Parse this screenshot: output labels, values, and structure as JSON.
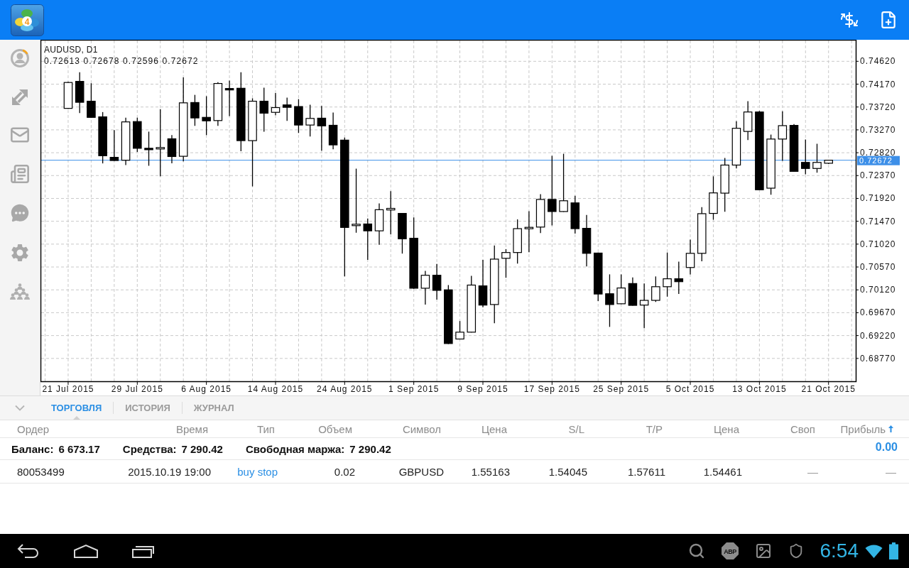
{
  "top_bar": {
    "logo_text": "4"
  },
  "chart": {
    "chart_data": [
      {
        "type": "candlestick",
        "title": "AUDUSD, D1",
        "subtitle": "0.72613 0.72678 0.72596 0.72672",
        "grid": true,
        "categories": [
          "21 Jul 2015",
          null,
          null,
          null,
          null,
          null,
          "29 Jul 2015",
          null,
          null,
          null,
          null,
          null,
          "6 Aug 2015",
          null,
          null,
          null,
          null,
          null,
          "14 Aug 2015",
          null,
          null,
          null,
          null,
          null,
          "24 Aug 2015",
          null,
          null,
          null,
          null,
          null,
          "1 Sep 2015",
          null,
          null,
          null,
          null,
          null,
          "9 Sep 2015",
          null,
          null,
          null,
          null,
          null,
          "17 Sep 2015",
          null,
          null,
          null,
          null,
          null,
          "25 Sep 2015",
          null,
          null,
          null,
          null,
          null,
          "5 Oct 2015",
          null,
          null,
          null,
          null,
          null,
          "13 Oct 2015",
          null,
          null,
          null,
          null,
          null,
          "21 Oct 2015"
        ],
        "ohlc": [
          [
            0.73693,
            0.74214,
            0.73683,
            0.74203
          ],
          [
            0.74224,
            0.74406,
            0.73599,
            0.73813
          ],
          [
            0.73834,
            0.74188,
            0.73511,
            0.73516
          ],
          [
            0.73526,
            0.7362,
            0.7261,
            0.72761
          ],
          [
            0.72729,
            0.73266,
            0.7266,
            0.72667
          ],
          [
            0.72672,
            0.73511,
            0.72578,
            0.73427
          ],
          [
            0.73433,
            0.73511,
            0.72834,
            0.72907
          ],
          [
            0.72907,
            0.73235,
            0.72563,
            0.72896
          ],
          [
            0.72896,
            0.73677,
            0.72355,
            0.72922
          ],
          [
            0.73094,
            0.73167,
            0.7261,
            0.72745
          ],
          [
            0.7275,
            0.74302,
            0.72651,
            0.73802
          ],
          [
            0.73808,
            0.73959,
            0.73349,
            0.73505
          ],
          [
            0.73516,
            0.73933,
            0.73167,
            0.73448
          ],
          [
            0.73453,
            0.74209,
            0.73349,
            0.74183
          ],
          [
            0.74084,
            0.7424,
            0.73542,
            0.74078
          ],
          [
            0.74089,
            0.74406,
            0.72849,
            0.73058
          ],
          [
            0.73058,
            0.73891,
            0.72157,
            0.73834
          ],
          [
            0.73834,
            0.74099,
            0.73235,
            0.73599
          ],
          [
            0.73615,
            0.73995,
            0.73558,
            0.73709
          ],
          [
            0.73761,
            0.73906,
            0.73448,
            0.73714
          ],
          [
            0.73729,
            0.73875,
            0.73209,
            0.73365
          ],
          [
            0.73365,
            0.73766,
            0.73141,
            0.73495
          ],
          [
            0.735,
            0.7374,
            0.7286,
            0.73349
          ],
          [
            0.7336,
            0.7361,
            0.72886,
            0.72974
          ],
          [
            0.73068,
            0.7312,
            0.70386,
            0.71349
          ],
          [
            0.71386,
            0.72506,
            0.71245,
            0.71412
          ],
          [
            0.71417,
            0.71526,
            0.70709,
            0.71282
          ],
          [
            0.71282,
            0.71823,
            0.71006,
            0.71698
          ],
          [
            0.71693,
            0.72063,
            0.71214,
            0.71724
          ],
          [
            0.71625,
            0.7163,
            0.70834,
            0.71125
          ],
          [
            0.71136,
            0.71547,
            0.70141,
            0.70152
          ],
          [
            0.70152,
            0.70495,
            0.69829,
            0.70407
          ],
          [
            0.70407,
            0.70631,
            0.69928,
            0.7011
          ],
          [
            0.7012,
            0.70214,
            0.69055,
            0.69063
          ],
          [
            0.69152,
            0.69506,
            0.69145,
            0.69287
          ],
          [
            0.69287,
            0.70396,
            0.6928,
            0.70214
          ],
          [
            0.70198,
            0.7071,
            0.69779,
            0.6982
          ],
          [
            0.69831,
            0.70994,
            0.69464,
            0.70725
          ],
          [
            0.70741,
            0.70922,
            0.70358,
            0.70855
          ],
          [
            0.70855,
            0.71506,
            0.70638,
            0.71325
          ],
          [
            0.71325,
            0.71667,
            0.7086,
            0.71351
          ],
          [
            0.71356,
            0.72003,
            0.71238,
            0.719
          ],
          [
            0.719,
            0.72758,
            0.71387,
            0.71662
          ],
          [
            0.71662,
            0.72799,
            0.71655,
            0.71874
          ],
          [
            0.71832,
            0.71972,
            0.71227,
            0.71325
          ],
          [
            0.71331,
            0.71594,
            0.70581,
            0.70839
          ],
          [
            0.70844,
            0.70855,
            0.69898,
            0.70038
          ],
          [
            0.70043,
            0.70425,
            0.69391,
            0.69831
          ],
          [
            0.69846,
            0.70425,
            0.6984,
            0.70157
          ],
          [
            0.70244,
            0.70363,
            0.6981,
            0.69815
          ],
          [
            0.6982,
            0.70244,
            0.69365,
            0.69913
          ],
          [
            0.69913,
            0.70384,
            0.69882,
            0.70182
          ],
          [
            0.70182,
            0.70855,
            0.69986,
            0.70338
          ],
          [
            0.70338,
            0.70674,
            0.70038,
            0.70281
          ],
          [
            0.7056,
            0.71108,
            0.70425,
            0.70839
          ],
          [
            0.70839,
            0.7175,
            0.70684,
            0.7162
          ],
          [
            0.71625,
            0.72355,
            0.71501,
            0.72029
          ],
          [
            0.72024,
            0.72717,
            0.71656,
            0.72577
          ],
          [
            0.72577,
            0.73441,
            0.7251,
            0.73301
          ],
          [
            0.73239,
            0.73834,
            0.73068,
            0.73622
          ],
          [
            0.73622,
            0.73642,
            0.72085,
            0.72091
          ],
          [
            0.72122,
            0.73177,
            0.71993,
            0.73089
          ],
          [
            0.73089,
            0.73637,
            0.7266,
            0.73353
          ],
          [
            0.73358,
            0.73384,
            0.7245,
            0.72453
          ],
          [
            0.72629,
            0.73079,
            0.72396,
            0.7251
          ],
          [
            0.7251,
            0.72996,
            0.72427,
            0.72629
          ],
          [
            0.72613,
            0.72678,
            0.72596,
            0.72672
          ]
        ],
        "ylim": [
          0.6832,
          0.7503
        ],
        "yticks": [
          {
            "value": 0.7462,
            "label": "0.74620"
          },
          {
            "value": 0.7417,
            "label": "0.74170"
          },
          {
            "value": 0.7372,
            "label": "0.73720"
          },
          {
            "value": 0.7327,
            "label": "0.73270"
          },
          {
            "value": 0.7282,
            "label": "0.72820"
          },
          {
            "value": 0.7237,
            "label": "0.72370"
          },
          {
            "value": 0.7192,
            "label": "0.71920"
          },
          {
            "value": 0.7147,
            "label": "0.71470"
          },
          {
            "value": 0.7102,
            "label": "0.71020"
          },
          {
            "value": 0.7057,
            "label": "0.70570"
          },
          {
            "value": 0.7012,
            "label": "0.70120"
          },
          {
            "value": 0.6967,
            "label": "0.69670"
          },
          {
            "value": 0.6922,
            "label": "0.69220"
          },
          {
            "value": 0.6877,
            "label": "0.68770"
          }
        ],
        "ref_lines": [
          {
            "axis": "y",
            "value": 0.72672,
            "label": "0.72672",
            "color": "#3d8fe8"
          }
        ]
      }
    ]
  },
  "trade_panel": {
    "tabs": [
      {
        "label": "ТОРГОВЛЯ",
        "selected": true
      },
      {
        "label": "ИСТОРИЯ",
        "selected": false
      },
      {
        "label": "ЖУРНАЛ",
        "selected": false
      }
    ],
    "columns": [
      {
        "label": "Ордер",
        "sorted": false
      },
      {
        "label": "Время",
        "sorted": false
      },
      {
        "label": "Тип",
        "sorted": false
      },
      {
        "label": "Объем",
        "sorted": false
      },
      {
        "label": "Символ",
        "sorted": false
      },
      {
        "label": "Цена",
        "sorted": false
      },
      {
        "label": "S/L",
        "sorted": false
      },
      {
        "label": "T/P",
        "sorted": false
      },
      {
        "label": "Цена",
        "sorted": false
      },
      {
        "label": "Своп",
        "sorted": false
      },
      {
        "label": "Прибыль",
        "sorted": true
      }
    ],
    "summary": [
      {
        "label": "Баланс:",
        "value": "6 673.17"
      },
      {
        "label": "Средства:",
        "value": "7 290.42"
      },
      {
        "label": "Свободная маржа:",
        "value": "7 290.42"
      }
    ],
    "total_profit": "0.00",
    "rows": [
      {
        "cells": [
          "80053499",
          "2015.10.19 19:00",
          "buy stop",
          "0.02",
          "GBPUSD",
          "1.55163",
          "1.54045",
          "1.57611",
          "1.54461",
          "—",
          "—"
        ]
      }
    ]
  },
  "system_bar": {
    "notification_icon_text": "ABP",
    "clock": "6:54"
  }
}
